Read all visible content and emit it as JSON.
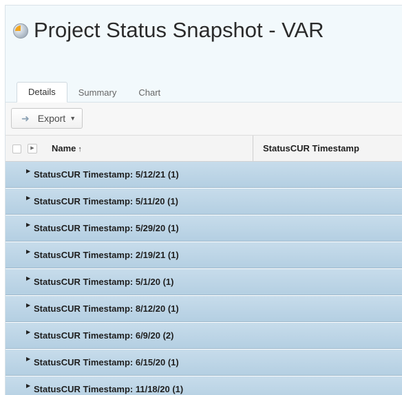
{
  "report": {
    "title": "Project Status Snapshot - VAR",
    "icon": "report-pie-icon"
  },
  "tabs": [
    {
      "label": "Details",
      "active": true
    },
    {
      "label": "Summary",
      "active": false
    },
    {
      "label": "Chart",
      "active": false
    }
  ],
  "toolbar": {
    "export_label": "Export",
    "export_icon": "arrow-right-icon",
    "caret_icon": "caret-down-icon"
  },
  "table": {
    "columns": [
      {
        "label": "Name",
        "sort": "ascending"
      },
      {
        "label": "StatusCUR Timestamp"
      }
    ],
    "rows": [
      {
        "label": "StatusCUR Timestamp: 5/12/21 (1)"
      },
      {
        "label": "StatusCUR Timestamp: 5/11/20 (1)"
      },
      {
        "label": "StatusCUR Timestamp: 5/29/20 (1)"
      },
      {
        "label": "StatusCUR Timestamp: 2/19/21 (1)"
      },
      {
        "label": "StatusCUR Timestamp: 5/1/20 (1)"
      },
      {
        "label": "StatusCUR Timestamp: 8/12/20 (1)"
      },
      {
        "label": "StatusCUR Timestamp: 6/9/20 (2)"
      },
      {
        "label": "StatusCUR Timestamp: 6/15/20 (1)"
      },
      {
        "label": "StatusCUR Timestamp: 11/18/20 (1)"
      }
    ]
  },
  "colors": {
    "header_bg": "#f2f9fc",
    "group_row_bg": "#bdd5e7",
    "accent_orange": "#f1a51f"
  }
}
